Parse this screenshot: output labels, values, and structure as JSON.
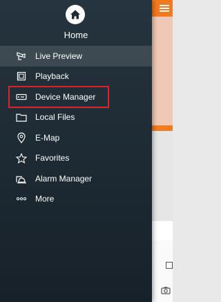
{
  "home": {
    "label": "Home",
    "icon": "home-icon"
  },
  "menu": [
    {
      "label": "Live Preview",
      "icon": "live-preview-icon",
      "active": true
    },
    {
      "label": "Playback",
      "icon": "playback-icon"
    },
    {
      "label": "Device Manager",
      "icon": "device-manager-icon",
      "highlighted": true
    },
    {
      "label": "Local Files",
      "icon": "folder-icon"
    },
    {
      "label": "E-Map",
      "icon": "map-pin-icon"
    },
    {
      "label": "Favorites",
      "icon": "star-icon"
    },
    {
      "label": "Alarm Manager",
      "icon": "alarm-icon"
    },
    {
      "label": "More",
      "icon": "more-icon"
    }
  ],
  "colors": {
    "drawer_bg": "#26343f",
    "accent_orange": "#f47a20",
    "highlight_red": "#e02028"
  }
}
